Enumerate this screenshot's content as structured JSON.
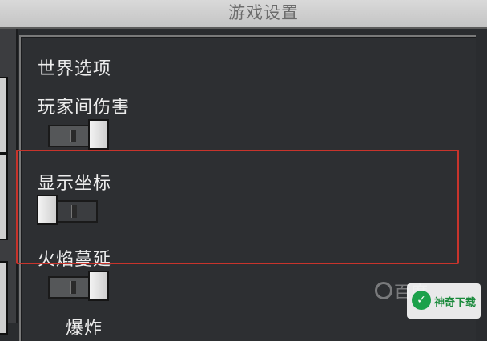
{
  "window": {
    "title": "游戏设置"
  },
  "settings": {
    "section_title": "世界选项",
    "pvp": {
      "label": "玩家间伤害",
      "enabled": true
    },
    "show_coordinates": {
      "label": "显示坐标",
      "enabled": false
    },
    "fire_spread": {
      "label": "火焰蔓延",
      "enabled": true
    },
    "next_label_partial": "爆炸"
  },
  "highlight_color": "#c8342c",
  "watermarks": {
    "left": "百度",
    "right": "神奇下载"
  }
}
